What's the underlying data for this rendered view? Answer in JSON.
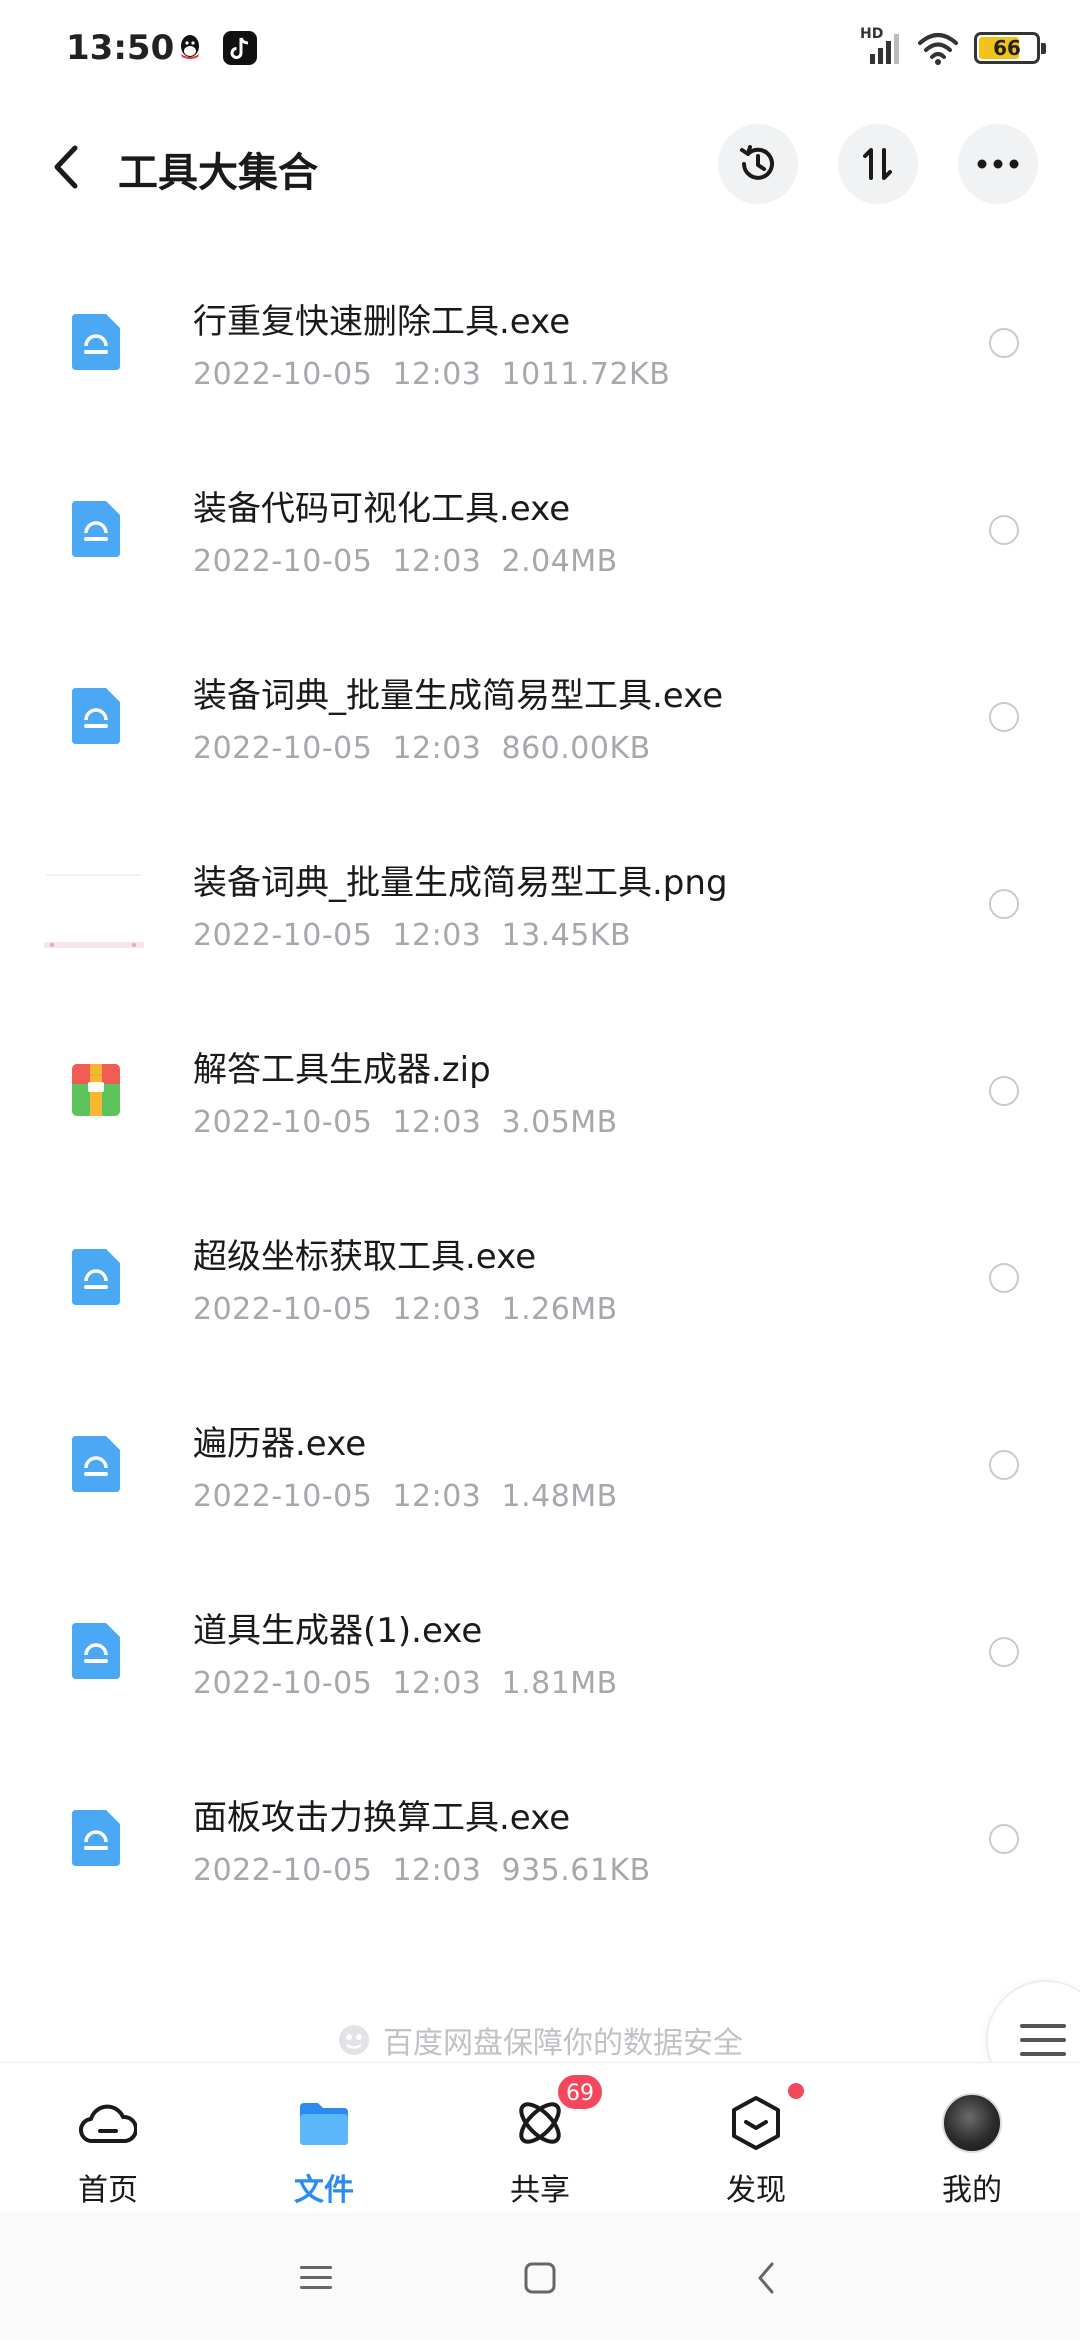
{
  "status_bar": {
    "time": "13:50",
    "network_label": "HD",
    "battery": "66",
    "battery_level": 0.66,
    "battery_color": "#f0c419"
  },
  "header": {
    "title": "工具大集合",
    "back_icon": "chevron-left-icon",
    "actions": [
      "history-icon",
      "sort-icon",
      "more-icon"
    ]
  },
  "files": [
    {
      "name": "行重复快速删除工具.exe",
      "date": "2022-10-05",
      "time": "12:03",
      "size": "1011.72KB",
      "type": "exe"
    },
    {
      "name": "装备代码可视化工具.exe",
      "date": "2022-10-05",
      "time": "12:03",
      "size": "2.04MB",
      "type": "exe"
    },
    {
      "name": "装备词典_批量生成简易型工具.exe",
      "date": "2022-10-05",
      "time": "12:03",
      "size": "860.00KB",
      "type": "exe"
    },
    {
      "name": "装备词典_批量生成简易型工具.png",
      "date": "2022-10-05",
      "time": "12:03",
      "size": "13.45KB",
      "type": "png"
    },
    {
      "name": "解答工具生成器.zip",
      "date": "2022-10-05",
      "time": "12:03",
      "size": "3.05MB",
      "type": "zip"
    },
    {
      "name": "超级坐标获取工具.exe",
      "date": "2022-10-05",
      "time": "12:03",
      "size": "1.26MB",
      "type": "exe"
    },
    {
      "name": "遍历器.exe",
      "date": "2022-10-05",
      "time": "12:03",
      "size": "1.48MB",
      "type": "exe"
    },
    {
      "name": "道具生成器(1).exe",
      "date": "2022-10-05",
      "time": "12:03",
      "size": "1.81MB",
      "type": "exe"
    },
    {
      "name": "面板攻击力换算工具.exe",
      "date": "2022-10-05",
      "time": "12:03",
      "size": "935.61KB",
      "type": "exe"
    }
  ],
  "footer_note": "百度网盘保障你的数据安全",
  "tabs": [
    {
      "label": "首页",
      "icon": "cloud-icon",
      "active": false
    },
    {
      "label": "文件",
      "icon": "folder-icon",
      "active": true
    },
    {
      "label": "共享",
      "icon": "share-icon",
      "active": false,
      "badge": "69"
    },
    {
      "label": "发现",
      "icon": "discover-icon",
      "active": false,
      "dot": true
    },
    {
      "label": "我的",
      "icon": "avatar",
      "active": false
    }
  ],
  "colors": {
    "accent": "#2a8cf0",
    "exe_icon": "#4aa8f5",
    "badge": "#f5475c",
    "meta_text": "#a6a8ad"
  }
}
